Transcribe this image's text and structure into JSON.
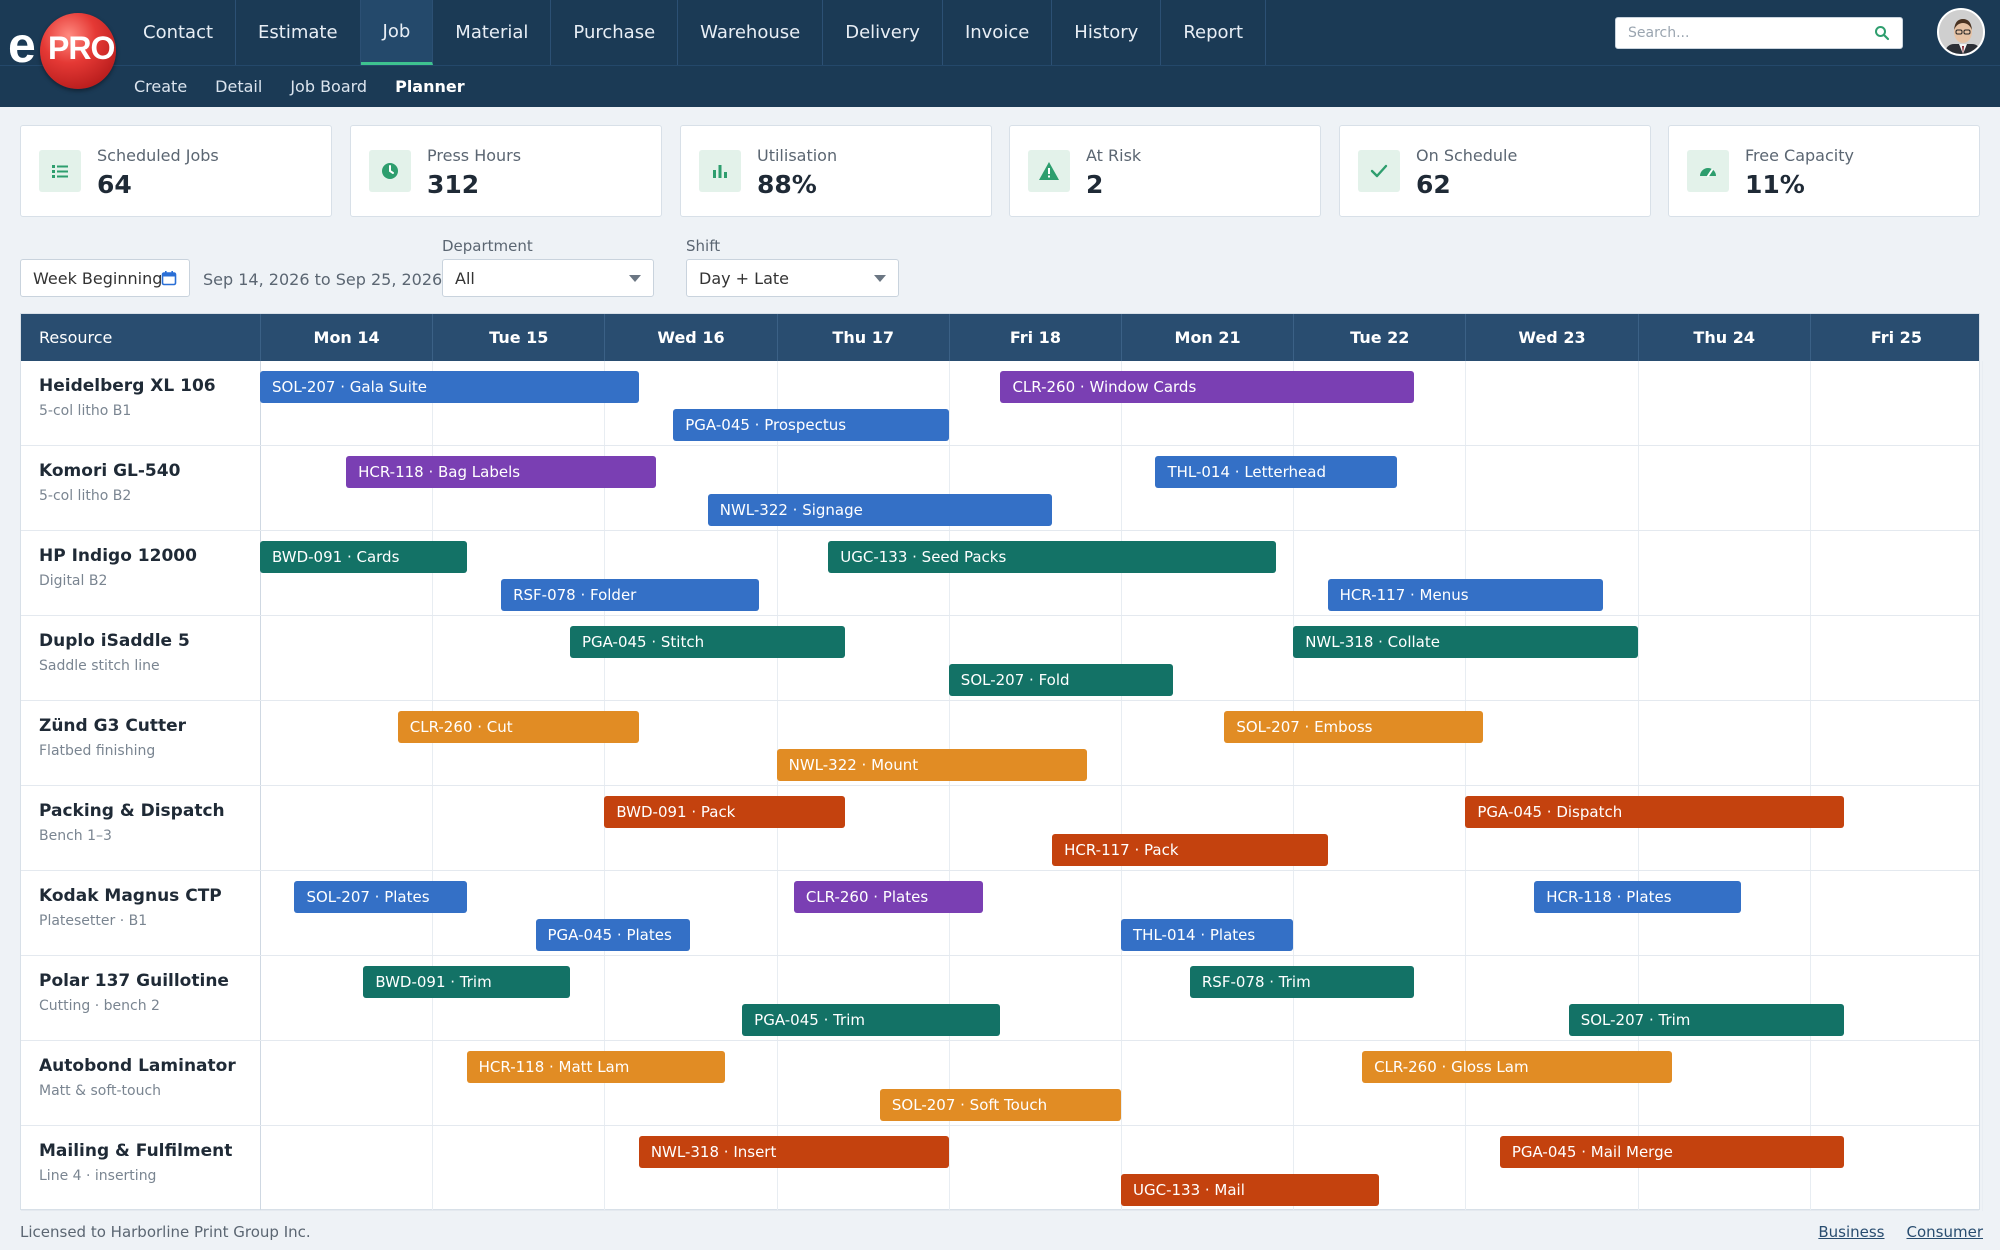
{
  "app": {
    "logo_text_e": "e",
    "logo_text_pro": "PRO"
  },
  "nav": {
    "items": [
      {
        "label": "Contact"
      },
      {
        "label": "Estimate"
      },
      {
        "label": "Job",
        "active": true
      },
      {
        "label": "Material"
      },
      {
        "label": "Purchase"
      },
      {
        "label": "Warehouse"
      },
      {
        "label": "Delivery"
      },
      {
        "label": "Invoice"
      },
      {
        "label": "History"
      },
      {
        "label": "Report"
      }
    ],
    "subitems": [
      {
        "label": "Create"
      },
      {
        "label": "Detail"
      },
      {
        "label": "Job Board"
      },
      {
        "label": "Planner",
        "active": true
      }
    ]
  },
  "search": {
    "placeholder": "Search..."
  },
  "kpis": [
    {
      "label": "Scheduled Jobs",
      "value": "64",
      "icon": "list-icon"
    },
    {
      "label": "Press Hours",
      "value": "312",
      "icon": "clock-icon"
    },
    {
      "label": "Utilisation",
      "value": "88%",
      "icon": "bar-chart-icon"
    },
    {
      "label": "At Risk",
      "value": "2",
      "icon": "warning-icon"
    },
    {
      "label": "On Schedule",
      "value": "62",
      "icon": "check-icon"
    },
    {
      "label": "Free Capacity",
      "value": "11%",
      "icon": "gauge-icon"
    }
  ],
  "filters": {
    "week_label": "Week Beginning",
    "date_range": "Sep 14, 2026 to Sep 25, 2026",
    "department_label": "Department",
    "department_value": "All",
    "shift_label": "Shift",
    "shift_value": "Day + Late"
  },
  "planner": {
    "resource_header": "Resource",
    "days": [
      "Mon 14",
      "Tue 15",
      "Wed 16",
      "Thu 17",
      "Fri 18",
      "Mon 21",
      "Tue 22",
      "Wed 23",
      "Thu 24",
      "Fri 25"
    ],
    "resources": [
      {
        "name": "Heidelberg XL 106",
        "sub": "5-col litho B1",
        "jobs": [
          {
            "label": "SOL-207 · Gala Suite",
            "color": "blue",
            "lane": 0,
            "start": 0.0,
            "end": 2.2
          },
          {
            "label": "CLR-260 · Window Cards",
            "color": "purple",
            "lane": 0,
            "start": 4.3,
            "end": 6.7
          },
          {
            "label": "PGA-045 · Prospectus",
            "color": "blue",
            "lane": 1,
            "start": 2.4,
            "end": 4.0
          }
        ]
      },
      {
        "name": "Komori GL-540",
        "sub": "5-col litho B2",
        "jobs": [
          {
            "label": "HCR-118 · Bag Labels",
            "color": "purple",
            "lane": 0,
            "start": 0.5,
            "end": 2.3
          },
          {
            "label": "THL-014 · Letterhead",
            "color": "blue",
            "lane": 0,
            "start": 5.2,
            "end": 6.6
          },
          {
            "label": "NWL-322 · Signage",
            "color": "blue",
            "lane": 1,
            "start": 2.6,
            "end": 4.6
          }
        ]
      },
      {
        "name": "HP Indigo 12000",
        "sub": "Digital B2",
        "jobs": [
          {
            "label": "BWD-091 · Cards",
            "color": "green",
            "lane": 0,
            "start": 0.0,
            "end": 1.2
          },
          {
            "label": "UGC-133 · Seed Packs",
            "color": "green",
            "lane": 0,
            "start": 3.3,
            "end": 5.9
          },
          {
            "label": "RSF-078 · Folder",
            "color": "blue",
            "lane": 1,
            "start": 1.4,
            "end": 2.9
          },
          {
            "label": "HCR-117 · Menus",
            "color": "blue",
            "lane": 1,
            "start": 6.2,
            "end": 7.8
          }
        ]
      },
      {
        "name": "Duplo iSaddle 5",
        "sub": "Saddle stitch line",
        "jobs": [
          {
            "label": "PGA-045 · Stitch",
            "color": "green",
            "lane": 0,
            "start": 1.8,
            "end": 3.4
          },
          {
            "label": "NWL-318 · Collate",
            "color": "green",
            "lane": 0,
            "start": 6.0,
            "end": 8.0
          },
          {
            "label": "SOL-207 · Fold",
            "color": "green",
            "lane": 1,
            "start": 4.0,
            "end": 5.3
          }
        ]
      },
      {
        "name": "Zünd G3 Cutter",
        "sub": "Flatbed finishing",
        "jobs": [
          {
            "label": "CLR-260 · Cut",
            "color": "orange",
            "lane": 0,
            "start": 0.8,
            "end": 2.2
          },
          {
            "label": "SOL-207 · Emboss",
            "color": "orange",
            "lane": 0,
            "start": 5.6,
            "end": 7.1
          },
          {
            "label": "NWL-322 · Mount",
            "color": "orange",
            "lane": 1,
            "start": 3.0,
            "end": 4.8
          }
        ]
      },
      {
        "name": "Packing & Dispatch",
        "sub": "Bench 1–3",
        "jobs": [
          {
            "label": "BWD-091 · Pack",
            "color": "red",
            "lane": 0,
            "start": 2.0,
            "end": 3.4
          },
          {
            "label": "PGA-045 · Dispatch",
            "color": "red",
            "lane": 0,
            "start": 7.0,
            "end": 9.2
          },
          {
            "label": "HCR-117 · Pack",
            "color": "red",
            "lane": 1,
            "start": 4.6,
            "end": 6.2
          }
        ]
      },
      {
        "name": "Kodak Magnus CTP",
        "sub": "Platesetter · B1",
        "jobs": [
          {
            "label": "SOL-207 · Plates",
            "color": "blue",
            "lane": 0,
            "start": 0.2,
            "end": 1.2
          },
          {
            "label": "CLR-260 · Plates",
            "color": "purple",
            "lane": 0,
            "start": 3.1,
            "end": 4.2
          },
          {
            "label": "HCR-118 · Plates",
            "color": "blue",
            "lane": 0,
            "start": 7.4,
            "end": 8.6
          },
          {
            "label": "PGA-045 · Plates",
            "color": "blue",
            "lane": 1,
            "start": 1.6,
            "end": 2.5
          },
          {
            "label": "THL-014 · Plates",
            "color": "blue",
            "lane": 1,
            "start": 5.0,
            "end": 6.0
          }
        ]
      },
      {
        "name": "Polar 137 Guillotine",
        "sub": "Cutting · bench 2",
        "jobs": [
          {
            "label": "BWD-091 · Trim",
            "color": "green",
            "lane": 0,
            "start": 0.6,
            "end": 1.8
          },
          {
            "label": "RSF-078 · Trim",
            "color": "green",
            "lane": 0,
            "start": 5.4,
            "end": 6.7
          },
          {
            "label": "PGA-045 · Trim",
            "color": "green",
            "lane": 1,
            "start": 2.8,
            "end": 4.3
          },
          {
            "label": "SOL-207 · Trim",
            "color": "green",
            "lane": 1,
            "start": 7.6,
            "end": 9.2
          }
        ]
      },
      {
        "name": "Autobond Laminator",
        "sub": "Matt & soft-touch",
        "jobs": [
          {
            "label": "HCR-118 · Matt Lam",
            "color": "orange",
            "lane": 0,
            "start": 1.2,
            "end": 2.7
          },
          {
            "label": "CLR-260 · Gloss Lam",
            "color": "orange",
            "lane": 0,
            "start": 6.4,
            "end": 8.2
          },
          {
            "label": "SOL-207 · Soft Touch",
            "color": "orange",
            "lane": 1,
            "start": 3.6,
            "end": 5.0
          }
        ]
      },
      {
        "name": "Mailing & Fulfilment",
        "sub": "Line 4 · inserting",
        "jobs": [
          {
            "label": "NWL-318 · Insert",
            "color": "red",
            "lane": 0,
            "start": 2.2,
            "end": 4.0
          },
          {
            "label": "PGA-045 · Mail Merge",
            "color": "red",
            "lane": 0,
            "start": 7.2,
            "end": 9.2
          },
          {
            "label": "UGC-133 · Mail",
            "color": "red",
            "lane": 1,
            "start": 5.0,
            "end": 6.5
          }
        ]
      }
    ]
  },
  "colors": {
    "blue": "#3470c6",
    "purple": "#7a3fb3",
    "green": "#137266",
    "orange": "#e18c24",
    "red": "#c4420e",
    "header": "#1b3a55",
    "accent": "#3ec28f"
  },
  "footer": {
    "license": "Licensed to Harborline Print Group Inc.",
    "links": [
      "Business",
      "Consumer"
    ]
  }
}
